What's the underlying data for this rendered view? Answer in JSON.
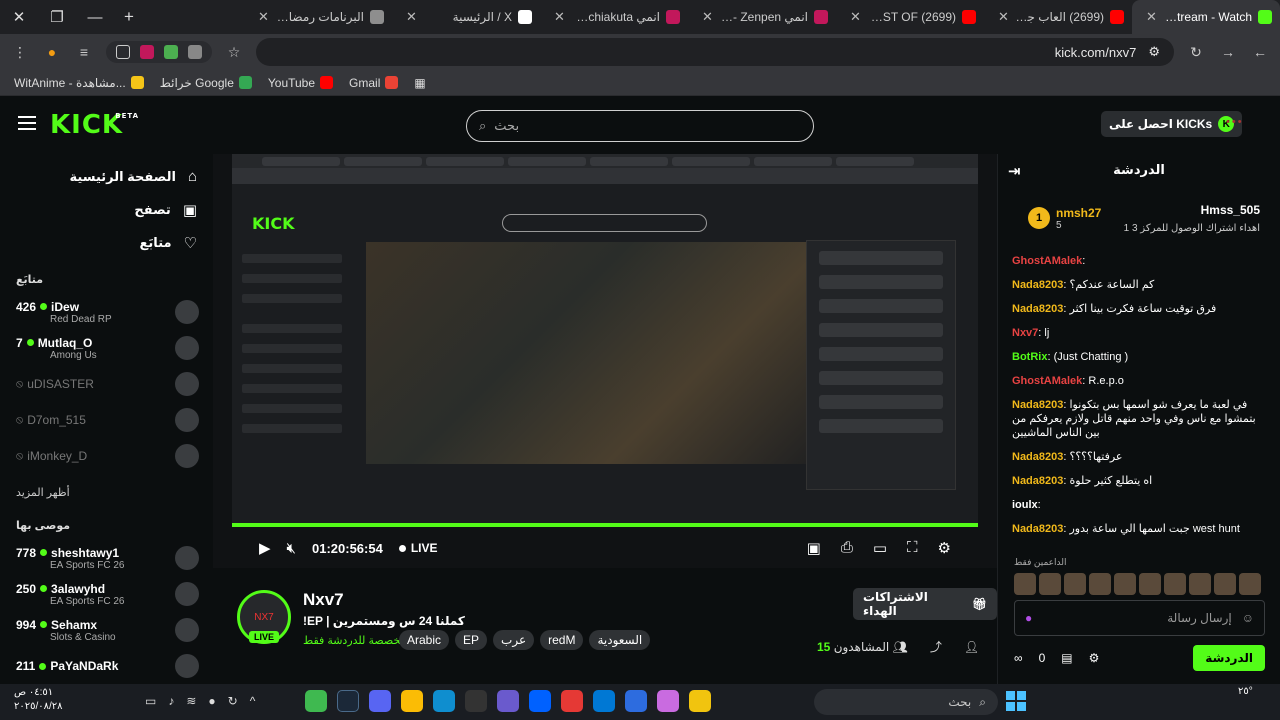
{
  "browser": {
    "tabs": [
      {
        "title": "Nxv7 Stream - Watch",
        "active": true,
        "color": "#53fc18"
      },
      {
        "title": "(2699) العاب جماعية",
        "active": false,
        "color": "#ff0000"
      },
      {
        "title": "(2699) THE LAST OF",
        "active": false,
        "color": "#ff0000"
      },
      {
        "title": "انمي Kaiyuu - Zenpen",
        "active": false,
        "color": "#c2185b"
      },
      {
        "title": "انمي Gachiakuta الحلـ",
        "active": false,
        "color": "#c2185b"
      },
      {
        "title": "X / الرئيسية",
        "active": false,
        "color": "#ffffff"
      },
      {
        "title": "البرنامات رمضانية - Alert",
        "active": false,
        "color": "#8e8e8e"
      }
    ],
    "url": "kick.com/nxv7",
    "bookmarks": [
      {
        "label": "Gmail",
        "color": "#ea4335"
      },
      {
        "label": "YouTube",
        "color": "#ff0000"
      },
      {
        "label": "خرائط Google",
        "color": "#34a853"
      },
      {
        "label": "WitAnime - مشاهدة...",
        "color": "#f5c518"
      }
    ]
  },
  "header": {
    "search_placeholder": "بحث",
    "get_kicks": "احصل على KICKs",
    "beta": "BETA"
  },
  "sidebar": {
    "nav": [
      {
        "label": "الصفحة الرئيسية",
        "icon": "home-icon"
      },
      {
        "label": "تصفح",
        "icon": "browse-icon"
      },
      {
        "label": "متابَع",
        "icon": "heart-icon"
      }
    ],
    "following_title": "متابَع",
    "following": [
      {
        "viewers": "426",
        "name": "iDew",
        "game": "Red Dead RP",
        "live": true
      },
      {
        "viewers": "7",
        "name": "Mutlaq_O",
        "game": "Among Us",
        "live": true
      },
      {
        "viewers": "",
        "name": "uDISASTER",
        "game": "",
        "live": false
      },
      {
        "viewers": "",
        "name": "D7om_515",
        "game": "",
        "live": false
      },
      {
        "viewers": "",
        "name": "iMonkey_D",
        "game": "",
        "live": false
      }
    ],
    "show_more": "أظهر المزيد",
    "recommended_title": "موصى بها",
    "recommended": [
      {
        "viewers": "778",
        "name": "sheshtawy1",
        "game": "EA Sports FC 26"
      },
      {
        "viewers": "250",
        "name": "3alawyhd",
        "game": "EA Sports FC 26"
      },
      {
        "viewers": "994",
        "name": "Sehamx",
        "game": "Slots & Casino"
      },
      {
        "viewers": "211",
        "name": "PaYaNDaRk",
        "game": ""
      }
    ]
  },
  "player": {
    "time": "01:20:56:54",
    "live_label": "LIVE"
  },
  "stream": {
    "name": "Nxv7",
    "title": "!EP | كملنا 24 س ومستمرين",
    "category": "مخصصة للدردشة فقط",
    "live_badge": "LIVE",
    "tags": [
      "Arabic",
      "EP",
      "عرب",
      "redM",
      "السعودية"
    ],
    "subs_button": "الاشتراكات الهداء",
    "viewers_label": "المشاهدون",
    "viewers": "15"
  },
  "chat": {
    "title": "الدردشة",
    "pinned": [
      {
        "rank": "1",
        "name": "nmsh27",
        "count": "5"
      },
      {
        "name": "Hmss_505",
        "sub": "1 اهداء اشتراك الوصول للمركز 3"
      }
    ],
    "messages": [
      {
        "user": "GhostAMalek",
        "color": "#e84343",
        "text": ""
      },
      {
        "user": "Nada8203",
        "color": "#f1b91b",
        "text": "كم الساعة عندكم؟"
      },
      {
        "user": "Nada8203",
        "color": "#f1b91b",
        "text": "فرق توقيت ساعة فكرت بينا اكثر"
      },
      {
        "user": "Nxv7",
        "color": "#e84343",
        "text": "lj"
      },
      {
        "user": "BotRix",
        "color": "#53fc18",
        "text": "(Just Chatting )"
      },
      {
        "user": "GhostAMalek",
        "color": "#e84343",
        "text": "R.e.p.o"
      },
      {
        "user": "Nada8203",
        "color": "#f1b91b",
        "text": "في لعبة ما يعرف شو اسمها بس بتكونوا بتمشوا مع ناس وفي واحد منهم قاتل ولازم يعرفكم من بين الناس الماشيين"
      },
      {
        "user": "Nada8203",
        "color": "#f1b91b",
        "text": "عرفتها؟؟؟؟"
      },
      {
        "user": "Nada8203",
        "color": "#f1b91b",
        "text": "اه يتطلع كثير حلوة"
      },
      {
        "user": "ioulx",
        "color": "#ffffff",
        "text": ""
      },
      {
        "user": "Nada8203",
        "color": "#f1b91b",
        "text": "جبت اسمها الي ساعة بدور west hunt"
      }
    ],
    "supporters_label": "الداعمين فقط",
    "input_placeholder": "إرسال رسالة",
    "points": "0",
    "send_button": "الدردشة"
  },
  "taskbar": {
    "time": "٠٤:٥١ ص",
    "date": "٢٠٢٥/٠٨/٢٨",
    "search": "بحث",
    "weather": "٢٥°"
  }
}
